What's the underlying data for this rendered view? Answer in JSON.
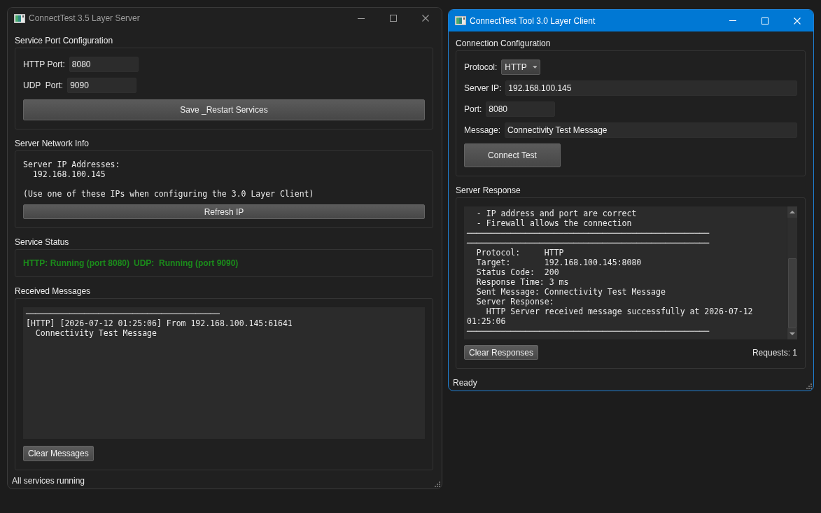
{
  "server_window": {
    "title": "ConnectTest 3.5 Layer Server",
    "active": false,
    "port_config": {
      "title": "Service Port Configuration",
      "fields": [
        {
          "kind": "number",
          "label": "HTTP Port:",
          "value": "8080"
        },
        {
          "kind": "number",
          "label": "UDP  Port:",
          "value": "9090"
        }
      ],
      "button": "Save _Restart Services"
    },
    "network_info": {
      "title": "Server Network Info",
      "blocks": [
        [
          "Server IP Addresses:",
          "  192.168.100.145"
        ],
        [
          "(Use one of these IPs when configuring the 3.0 Layer Client)"
        ]
      ],
      "button": "Refresh IP"
    },
    "service_status": {
      "title": "Service Status",
      "items": [
        {
          "text": "HTTP: Running (port 8080)",
          "running": true
        },
        {
          "text": "UDP:  Running (port 9090)",
          "running": true
        }
      ]
    },
    "received_messages": {
      "title": "Received Messages",
      "lines": [
        "────────────────────────────────────────",
        "[HTTP] [2026-07-12 01:25:06] From 192.168.100.145:61641",
        "  Connectivity Test Message"
      ],
      "button": "Clear Messages"
    },
    "status_bar": "All services running"
  },
  "client_window": {
    "title": "ConnectTest Tool 3.0 Layer Client",
    "active": true,
    "connection_config": {
      "title": "Connection Configuration",
      "fields": [
        {
          "kind": "dropdown",
          "label": "Protocol:",
          "value": "HTTP"
        },
        {
          "kind": "text",
          "label": "Server IP:",
          "value": "192.168.100.145"
        },
        {
          "kind": "number",
          "label": "Port:",
          "value": "8080"
        },
        {
          "kind": "text",
          "label": "Message:",
          "value": "Connectivity Test Message"
        }
      ],
      "button": "Connect Test"
    },
    "server_response": {
      "title": "Server Response",
      "lines": [
        "  - IP address and port are correct",
        "  - Firewall allows the connection",
        "──────────────────────────────────────────────────",
        "──────────────────────────────────────────────────",
        "  Protocol:     HTTP",
        "  Target:       192.168.100.145:8080",
        "  Status Code:  200",
        "  Response Time: 3 ms",
        "  Sent Message: Connectivity Test Message",
        "  Server Response:",
        "    HTTP Server received message successfully at 2026-07-12",
        "01:25:06",
        "──────────────────────────────────────────────────"
      ],
      "button": "Clear Responses",
      "request_count": "Requests: 1"
    },
    "status_bar": "Ready"
  }
}
